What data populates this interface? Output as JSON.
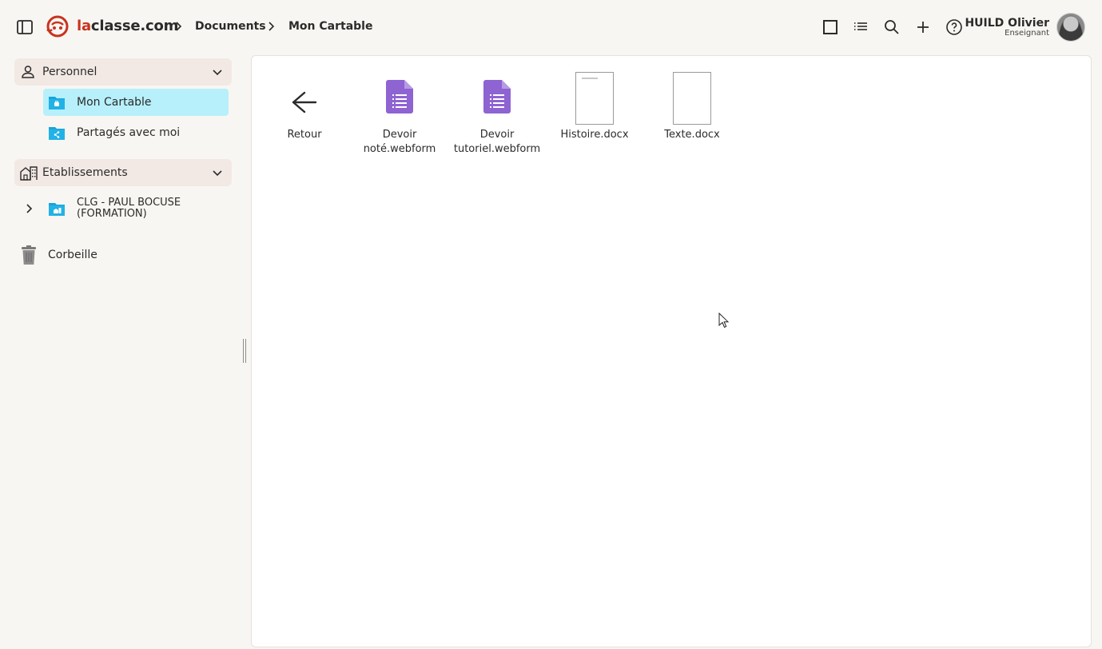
{
  "header": {
    "brand_prefix": "la",
    "brand_suffix": "classe.com",
    "breadcrumbs": [
      "Documents",
      "Mon Cartable"
    ],
    "toolbar": [
      "grid-view-icon",
      "list-view-icon",
      "search-icon",
      "add-icon",
      "help-icon"
    ],
    "user": {
      "name": "HUILD Olivier",
      "role": "Enseignant"
    }
  },
  "sidebar": {
    "personnel": {
      "label": "Personnel",
      "items": [
        {
          "label": "Mon Cartable",
          "active": true
        },
        {
          "label": "Partagés avec moi",
          "active": false
        }
      ]
    },
    "etablissements": {
      "label": "Etablissements",
      "items": [
        {
          "label": "CLG - PAUL BOCUSE (FORMATION)"
        }
      ]
    },
    "trash": {
      "label": "Corbeille"
    }
  },
  "files": [
    {
      "name": "Retour",
      "kind": "back"
    },
    {
      "name": "Devoir noté.webform",
      "kind": "webform"
    },
    {
      "name": "Devoir tutoriel.webform",
      "kind": "webform"
    },
    {
      "name": "Histoire.docx",
      "kind": "docx"
    },
    {
      "name": "Texte.docx",
      "kind": "docx"
    }
  ],
  "colors": {
    "accent_red": "#c8331f",
    "active_item": "#b7f0fb",
    "section_bg": "#f2e9e4",
    "folder_blue": "#1aa3d6",
    "webform_purple": "#8e63d2"
  }
}
